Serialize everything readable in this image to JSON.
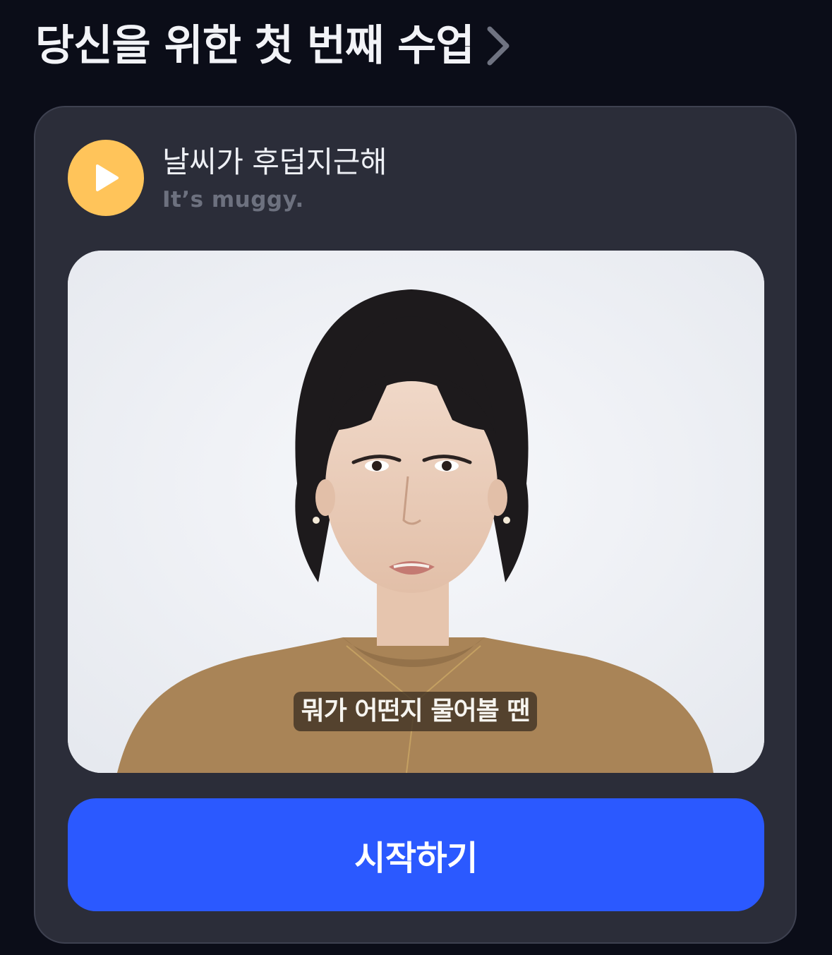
{
  "section": {
    "title": "당신을 위한 첫 번째 수업",
    "chevron_icon": "chevron-right-icon"
  },
  "lesson": {
    "korean_phrase": "날씨가 후덥지근해",
    "english_translation": "It’s muggy.",
    "play_icon": "play-icon",
    "video": {
      "subtitle": "뭐가 어떤지 물어볼 땐"
    },
    "start_button_label": "시작하기"
  },
  "colors": {
    "background": "#0b0d18",
    "card": "#2b2d39",
    "play_button": "#ffc45a",
    "primary_button": "#2b59ff",
    "secondary_text": "#6d717f"
  }
}
